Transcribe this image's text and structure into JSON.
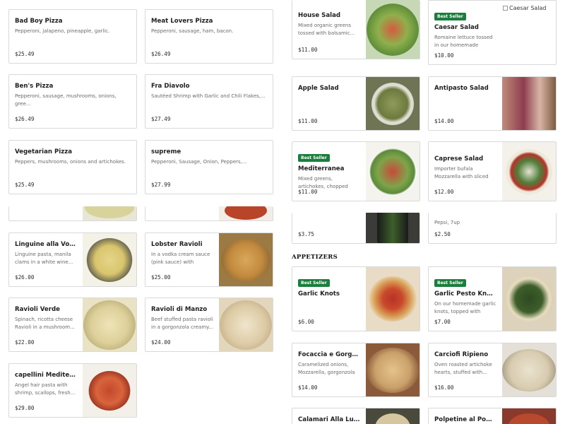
{
  "left_top_cards": [
    {
      "name": "Bad Boy Pizza",
      "desc": "Pepperoni, jalapeno, pineapple, garlic.",
      "price": "$25.49"
    },
    {
      "name": "Meat Lovers Pizza",
      "desc": "Pepperoni, sausage, ham, bacon.",
      "price": "$26.49"
    },
    {
      "name": "Ben's Pizza",
      "desc": "Pepperoni, sausage, mushrooms, onions, gree...",
      "price": "$26.49"
    },
    {
      "name": "Fra Diavolo",
      "desc": "Sautéed Shrimp with Garlic and Chili Flakes,...",
      "price": "$27.49"
    },
    {
      "name": "Vegetarian Pizza",
      "desc": "Peppers, mushrooms, onions and artichokes.",
      "price": "$25.49"
    },
    {
      "name": "supreme",
      "desc": "Pepperoni, Sausage, Onion, Peppers,...",
      "price": "$27.99"
    }
  ],
  "left_bottom_cards": [
    {
      "name": "Linguine alla Vongole",
      "desc": "Linguine pasta, manila clams in a white wine...",
      "price": "$26.00"
    },
    {
      "name": "Lobster Ravioli",
      "desc": "In a vodka cream sauce (pink sauce) with shaved...",
      "price": "$25.00"
    },
    {
      "name": "Ravioli Verde",
      "desc": "Spinach, ricotta cheese Ravioli in a mushroom...",
      "price": "$22.00"
    },
    {
      "name": "Ravioli di Manzo",
      "desc": "Beef stuffed pasta ravioli in a gorgonzola creamy...",
      "price": "$24.00"
    },
    {
      "name": "capellini Mediteraneo",
      "desc": "Angel hair pasta with shrimp, scallops, fresh...",
      "price": "$29.00"
    }
  ],
  "right_top_cards": [
    {
      "name": "House Salad",
      "desc": "Mixed organic greens tossed with balsamic...",
      "price": "$11.00",
      "badge": ""
    },
    {
      "name": "Caesar Salad",
      "desc": "Romaine lettuce tossed in our homemade Caesar...",
      "price": "$10.00",
      "badge": "Best Seller",
      "image_alt": "Caesar Salad"
    },
    {
      "name": "Apple Salad",
      "desc": "",
      "price": "$11.00",
      "badge": ""
    },
    {
      "name": "Antipasto Salad",
      "desc": "",
      "price": "$14.00",
      "badge": ""
    },
    {
      "name": "Mediterranea",
      "desc": "Mixed greens, artichokes, chopped tomato, black...",
      "price": "$11.00",
      "badge": "Best Seller"
    },
    {
      "name": "Caprese Salad",
      "desc": "Importer bufala Mozzarella with sliced tomatoes, fre...",
      "price": "$12.00",
      "badge": ""
    }
  ],
  "partial_strip": {
    "left_price": "$3.75",
    "right_desc": "Pepsi, 7up",
    "right_price": "$2.50"
  },
  "section": {
    "title": "APPETIZERS"
  },
  "appetizer_cards": [
    {
      "name": "Garlic Knots",
      "desc": "",
      "price": "$6.00",
      "badge": "Best Seller"
    },
    {
      "name": "Garlic Pesto Knots",
      "desc": "On our homemade garlic knots, topped with pesto...",
      "price": "$7.00",
      "badge": "Best Seller"
    },
    {
      "name": "Focaccia e Gorgonzola",
      "desc": "Caramelized onions, Mozzarella, gorgonzola a...",
      "price": "$14.00",
      "badge": ""
    },
    {
      "name": "Carciofi Ripieno",
      "desc": "Oven roasted artichoke hearts, stuffed with...",
      "price": "$16.00",
      "badge": ""
    },
    {
      "name": "Calamari Alla Luciana",
      "desc": "",
      "price": "",
      "badge": ""
    },
    {
      "name": "Polpetine al Pomodoro",
      "desc": "",
      "price": "",
      "badge": ""
    }
  ],
  "colors": {
    "badge": "#1a7f3c",
    "border": "#d9d9d9",
    "price": "#2a2a2a",
    "desc": "#6b6b6b"
  }
}
